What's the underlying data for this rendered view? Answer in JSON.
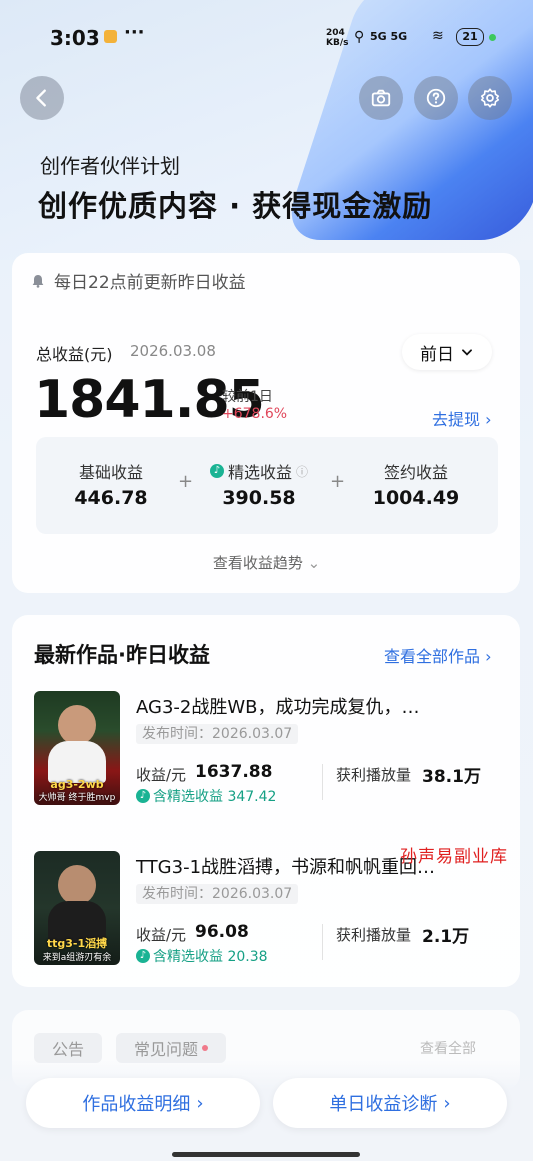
{
  "status_bar": {
    "time": "3:03",
    "dots": "···",
    "net_speed": "204 KB/s",
    "signal": "5G 5G",
    "battery": "21"
  },
  "header": {
    "subtitle": "创作者伙伴计划",
    "title": "创作优质内容 · 获得现金激励"
  },
  "notice": {
    "text": "每日22点前更新昨日收益"
  },
  "earnings": {
    "label": "总收益(元)",
    "date": "2026.03.08",
    "period": "前日",
    "amount": "1841.85",
    "compare_label": "较前1日",
    "compare_value": "+678.6%",
    "withdraw": "去提现",
    "breakdown": [
      {
        "label": "基础收益",
        "value": "446.78"
      },
      {
        "label": "精选收益",
        "value": "390.58"
      },
      {
        "label": "签约收益",
        "value": "1004.49"
      }
    ],
    "plus": "+",
    "trend": "查看收益趋势"
  },
  "works": {
    "title": "最新作品·昨日收益",
    "view_all": "查看全部作品",
    "items": [
      {
        "title": "AG3-2战胜WB，成功完成复仇，…",
        "date": "发布时间：2026.03.07",
        "income_label": "收益/元",
        "income": "1637.88",
        "selected": "含精选收益 347.42",
        "play_label": "获利播放量",
        "play": "38.1万",
        "thumb_caption": "ag3-2wb",
        "thumb_sub": "大帅哥 终于胜mvp"
      },
      {
        "title": "TTG3-1战胜滔搏，书源和帆帆重回…",
        "date": "发布时间：2026.03.07",
        "income_label": "收益/元",
        "income": "96.08",
        "selected": "含精选收益 20.38",
        "play_label": "获利播放量",
        "play": "2.1万",
        "thumb_caption": "ttg3-1滔搏",
        "thumb_sub": "来到a组游刃有余"
      }
    ]
  },
  "watermark": "孙声易副业库",
  "lower_tabs": {
    "tab1": "公告",
    "tab2": "常见问题",
    "more": "查看全部"
  },
  "bottom": {
    "btn1": "作品收益明细",
    "btn2": "单日收益诊断"
  },
  "colors": {
    "accent": "#2f6fe0",
    "up": "#e0475b",
    "selected": "#16a085"
  }
}
